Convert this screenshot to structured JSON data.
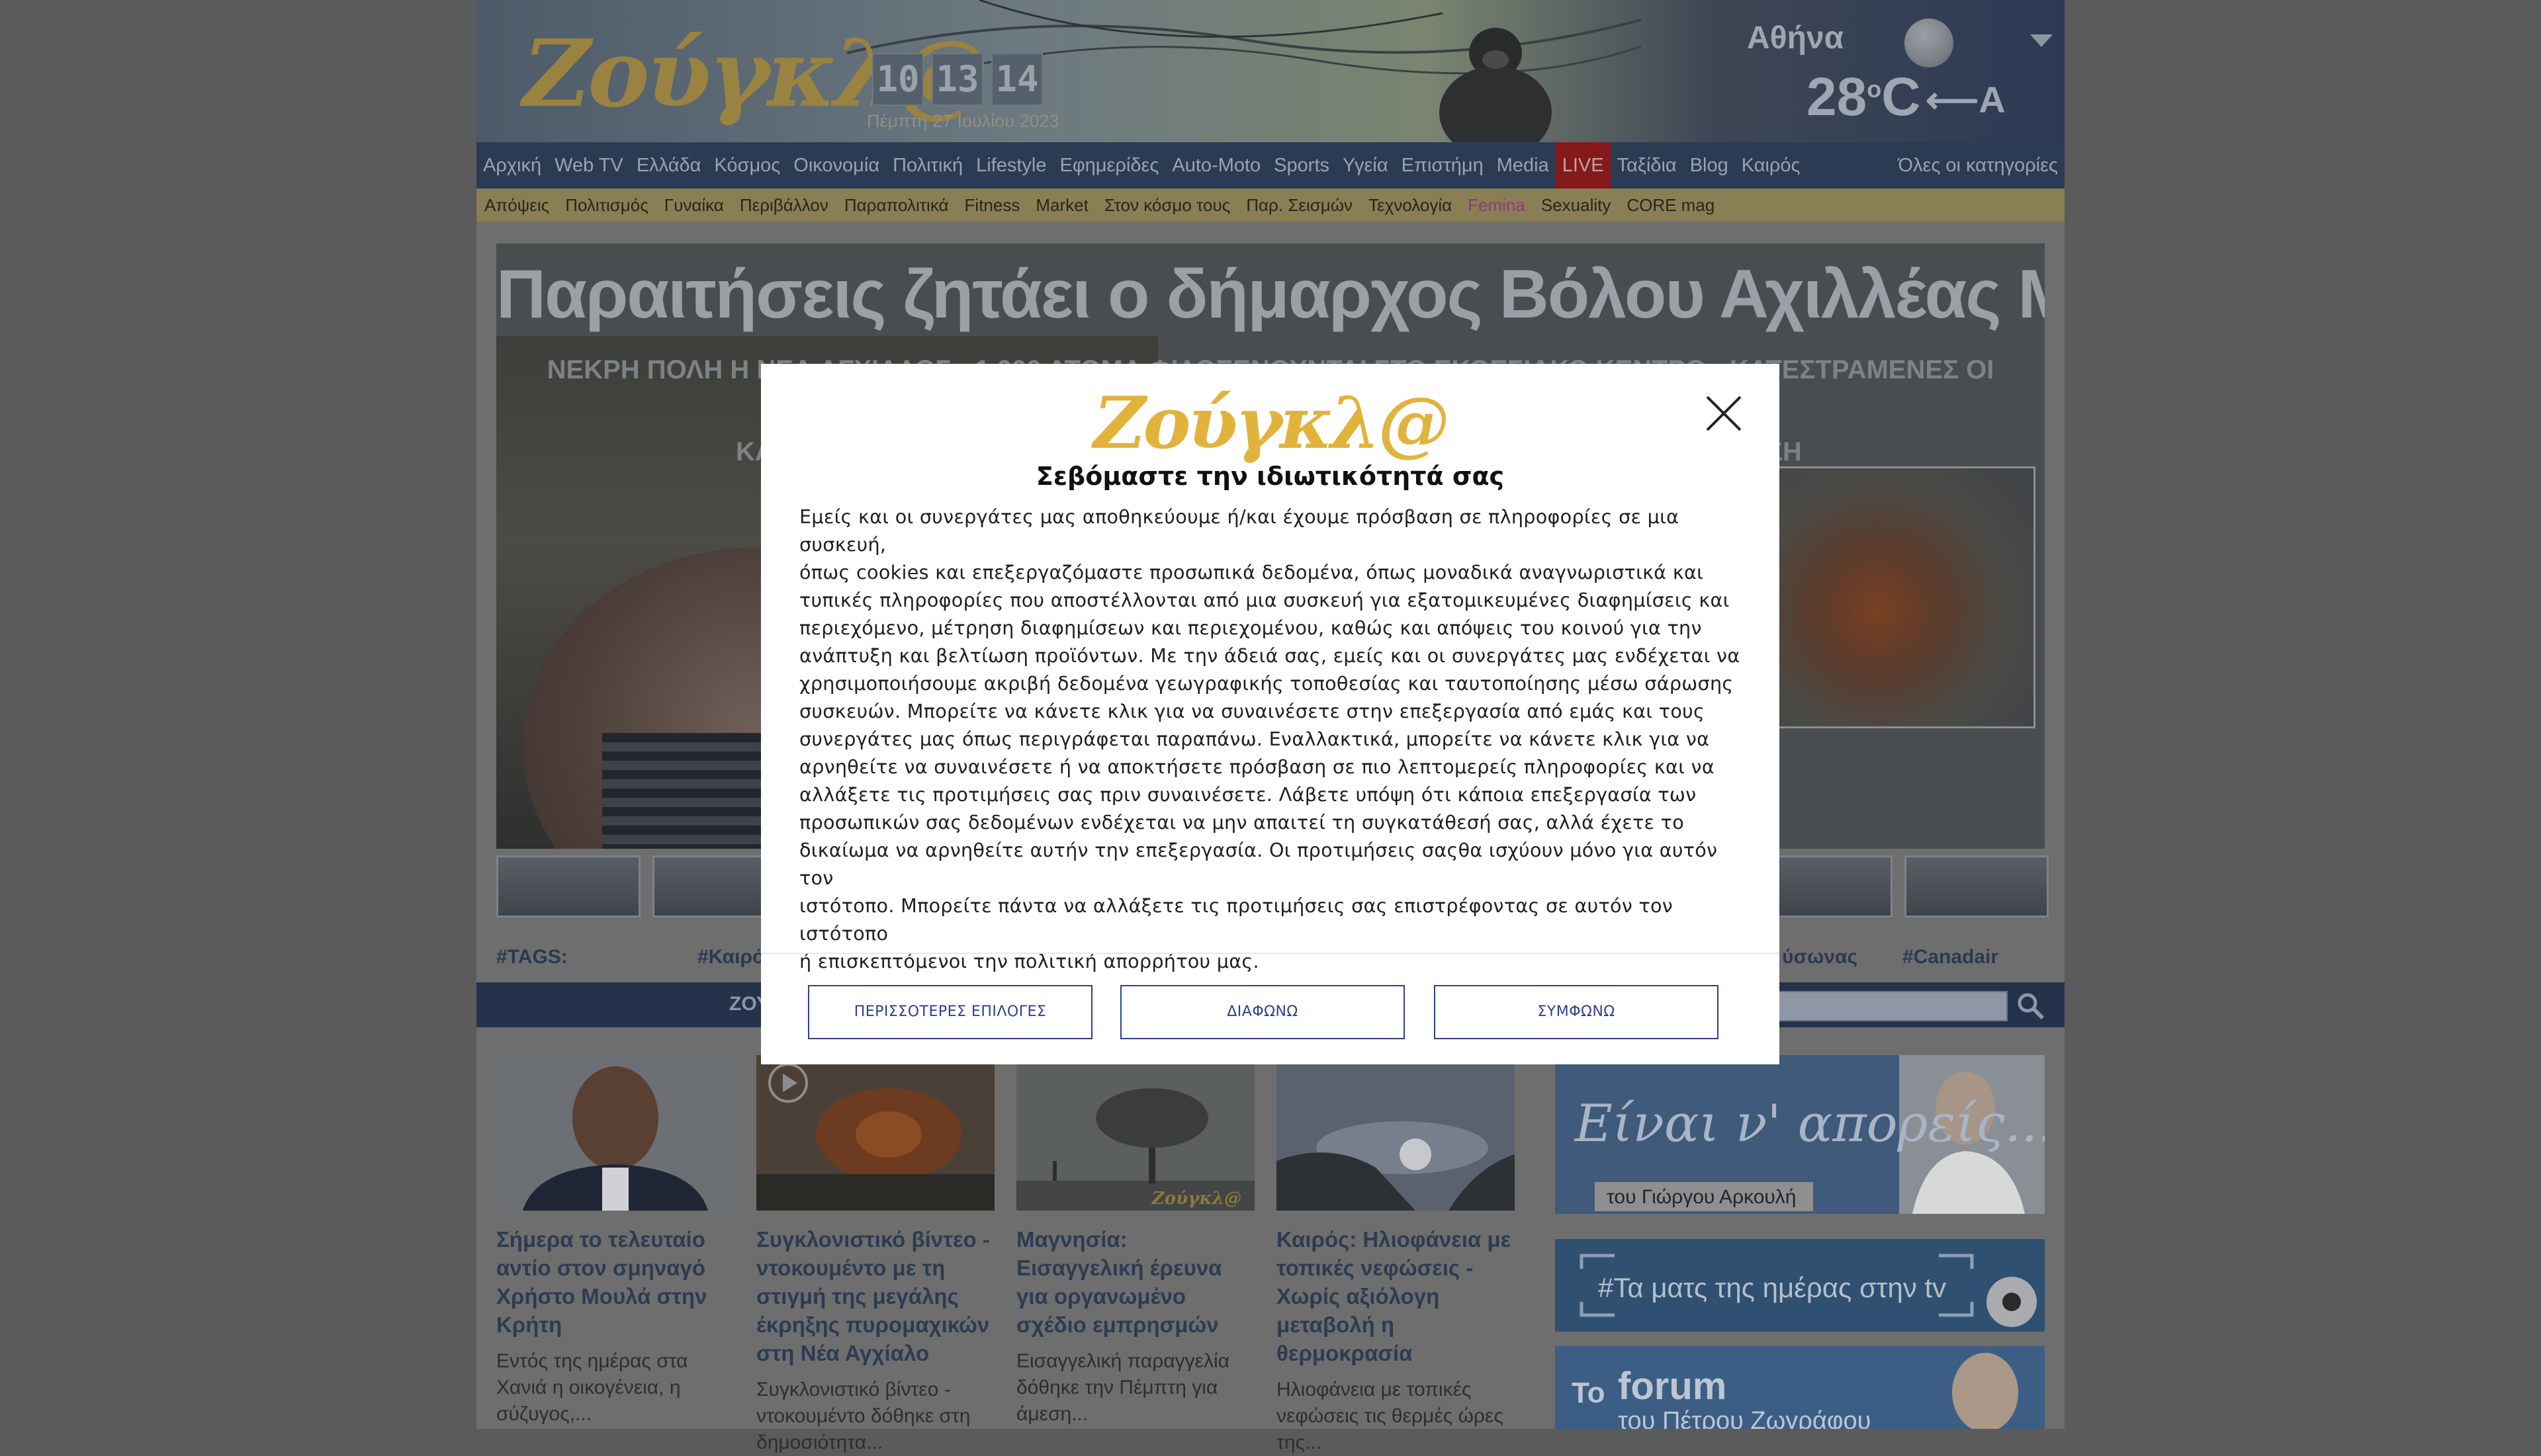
{
  "header": {
    "logo_text": "Ζούγκλ@",
    "clock": [
      "10",
      "13",
      "14"
    ],
    "date": "Πέμπτη 27 Ιουλίου 2023",
    "weather": {
      "city": "Αθήνα",
      "temperature": "28",
      "unit": "C",
      "degree_symbol": "o",
      "wind": "⟵A"
    }
  },
  "nav_primary": {
    "items": [
      "Αρχική",
      "Web TV",
      "Ελλάδα",
      "Κόσμος",
      "Οικονομία",
      "Πολιτική",
      "Lifestyle",
      "Εφημερίδες",
      "Auto-Moto",
      "Sports",
      "Υγεία",
      "Επιστήμη",
      "Media",
      "LIVE",
      "Ταξίδια",
      "Blog",
      "Καιρός"
    ],
    "all_categories": "Όλες οι κατηγορίες"
  },
  "nav_secondary": {
    "items": [
      "Απόψεις",
      "Πολιτισμός",
      "Γυναίκα",
      "Περιβάλλον",
      "Παραπολιτικά",
      "Fitness",
      "Market",
      "Στον κόσμο τους",
      "Παρ. Σεισμών",
      "Τεχνολογία",
      "Femina",
      "Sexuality",
      "CORE mag"
    ]
  },
  "hero": {
    "title": "Παραιτήσεις ζητάει ο δήμαρχος Βόλου Αχιλλέας Μπέος",
    "subtitle_line1": "ΝΕΚΡΗ ΠΟΛΗ Η ΝΕΑ ΑΓΧΙΑΛΟΣ - 1.000 ΑΤΟΜΑ ΦΙΛΟΞΕΝΟΥΝΤΑΙ ΣΤΟ ΕΚΘΕΣΙΑΚΟ ΚΕΝΤΡΟ - ΚΑΤΕΣΤΡΑΜΕΝΕΣ ΟΙ ΤΖΑΜΑΡΙΕΣ",
    "subtitle_line2_left": "ΚΑ",
    "subtitle_line2_right": "ΣΗ"
  },
  "tags": {
    "label": "#TAGS:",
    "items": [
      "#Καιρό",
      "ύσωνας",
      "#Canadair"
    ]
  },
  "bluebar": {
    "label": "ΖΟΥ"
  },
  "articles": [
    {
      "title": "Σήμερα το τελευταίο αντίο στον σμηναγό Χρήστο Μουλά στην Κρήτη",
      "desc": "Εντός της ημέρας στα Χανιά η οικογένεια, η σύζυγος,..."
    },
    {
      "title": "Συγκλονιστικό βίντεο - ντοκουμέντο με τη στιγμή της μεγάλης έκρηξης πυρομαχικών στη Νέα Αγχίαλο",
      "desc": "Συγκλονιστικό βίντεο - ντοκουμέντο δόθηκε στη δημοσιότητα..."
    },
    {
      "title": "Μαγνησία: Εισαγγελική έρευνα για οργανωμένο σχέδιο εμπρησμών",
      "desc": "Εισαγγελική παραγγελία δόθηκε την Πέμπτη για άμεση..."
    },
    {
      "title": "Καιρός: Ηλιοφάνεια με τοπικές νεφώσεις - Χωρίς αξιόλογη μεταβολή η θερμοκρασία",
      "desc": "Ηλιοφάνεια με τοπικές νεφώσεις τις θερμές ώρες της..."
    }
  ],
  "article_watermark": "Ζούγκλ@",
  "side_banners": {
    "banner1_title": "Είναι ν' απορείς...",
    "banner1_author": "του Γιώργου Αρκουλή",
    "banner2_title": "#Τα ματς της ημέρας στην tv",
    "banner3_title_a": "Το",
    "banner3_title_b": "forum",
    "banner3_sub": "του Πέτρου Ζωγράφου"
  },
  "consent_modal": {
    "logo_text": "Ζούγκλ@",
    "heading": "Σεβόμαστε την ιδιωτικότητά σας",
    "body_lines": [
      "Εμείς και οι συνεργάτες μας αποθηκεύουμε ή/και έχουμε πρόσβαση σε πληροφορίες σε μια συσκευή,",
      "όπως cookies και επεξεργαζόμαστε προσωπικά δεδομένα, όπως μοναδικά αναγνωριστικά και",
      "τυπικές πληροφορίες που αποστέλλονται από μια συσκευή για εξατομικευμένες διαφημίσεις και",
      "περιεχόμενο, μέτρηση διαφημίσεων και περιεχομένου, καθώς και απόψεις του κοινού για την",
      "ανάπτυξη και βελτίωση προϊόντων. Με την άδειά σας, εμείς και οι συνεργάτες μας ενδέχεται να",
      "χρησιμοποιήσουμε ακριβή δεδομένα γεωγραφικής τοποθεσίας και ταυτοποίησης μέσω σάρωσης",
      "συσκευών. Μπορείτε να κάνετε κλικ για να συναινέσετε στην επεξεργασία από εμάς και τους",
      "συνεργάτες μας όπως περιγράφεται παραπάνω. Εναλλακτικά, μπορείτε να κάνετε κλικ για να",
      "αρνηθείτε να συναινέσετε ή να αποκτήσετε πρόσβαση σε πιο λεπτομερείς πληροφορίες και να",
      "αλλάξετε τις προτιμήσεις σας πριν συναινέσετε. Λάβετε υπόψη ότι κάποια επεξεργασία των",
      "προσωπικών σας δεδομένων ενδέχεται να μην απαιτεί τη συγκατάθεσή σας, αλλά έχετε το",
      "δικαίωμα να αρνηθείτε αυτήν την επεξεργασία. Οι προτιμήσεις σαςθα ισχύουν μόνο για αυτόν τον",
      "ιστότοπο. Μπορείτε πάντα να αλλάξετε τις προτιμήσεις σας επιστρέφοντας σε αυτόν τον ιστότοπο",
      "ή επισκεπτόμενοι την πολιτική απορρήτου μας."
    ],
    "buttons": {
      "more_options": "ΠΕΡΙΣΣΟΤΕΡΕΣ ΕΠΙΛΟΓΕΣ",
      "disagree": "ΔΙΑΦΩΝΩ",
      "agree": "ΣΥΜΦΩΝΩ"
    }
  },
  "colors": {
    "nav_primary_bg": "#2c3b54",
    "nav_secondary_bg": "#8a7e55",
    "live_bg": "#861a1a",
    "modal_button": "#2f3e91",
    "modal_logo": "#e2b33c"
  }
}
